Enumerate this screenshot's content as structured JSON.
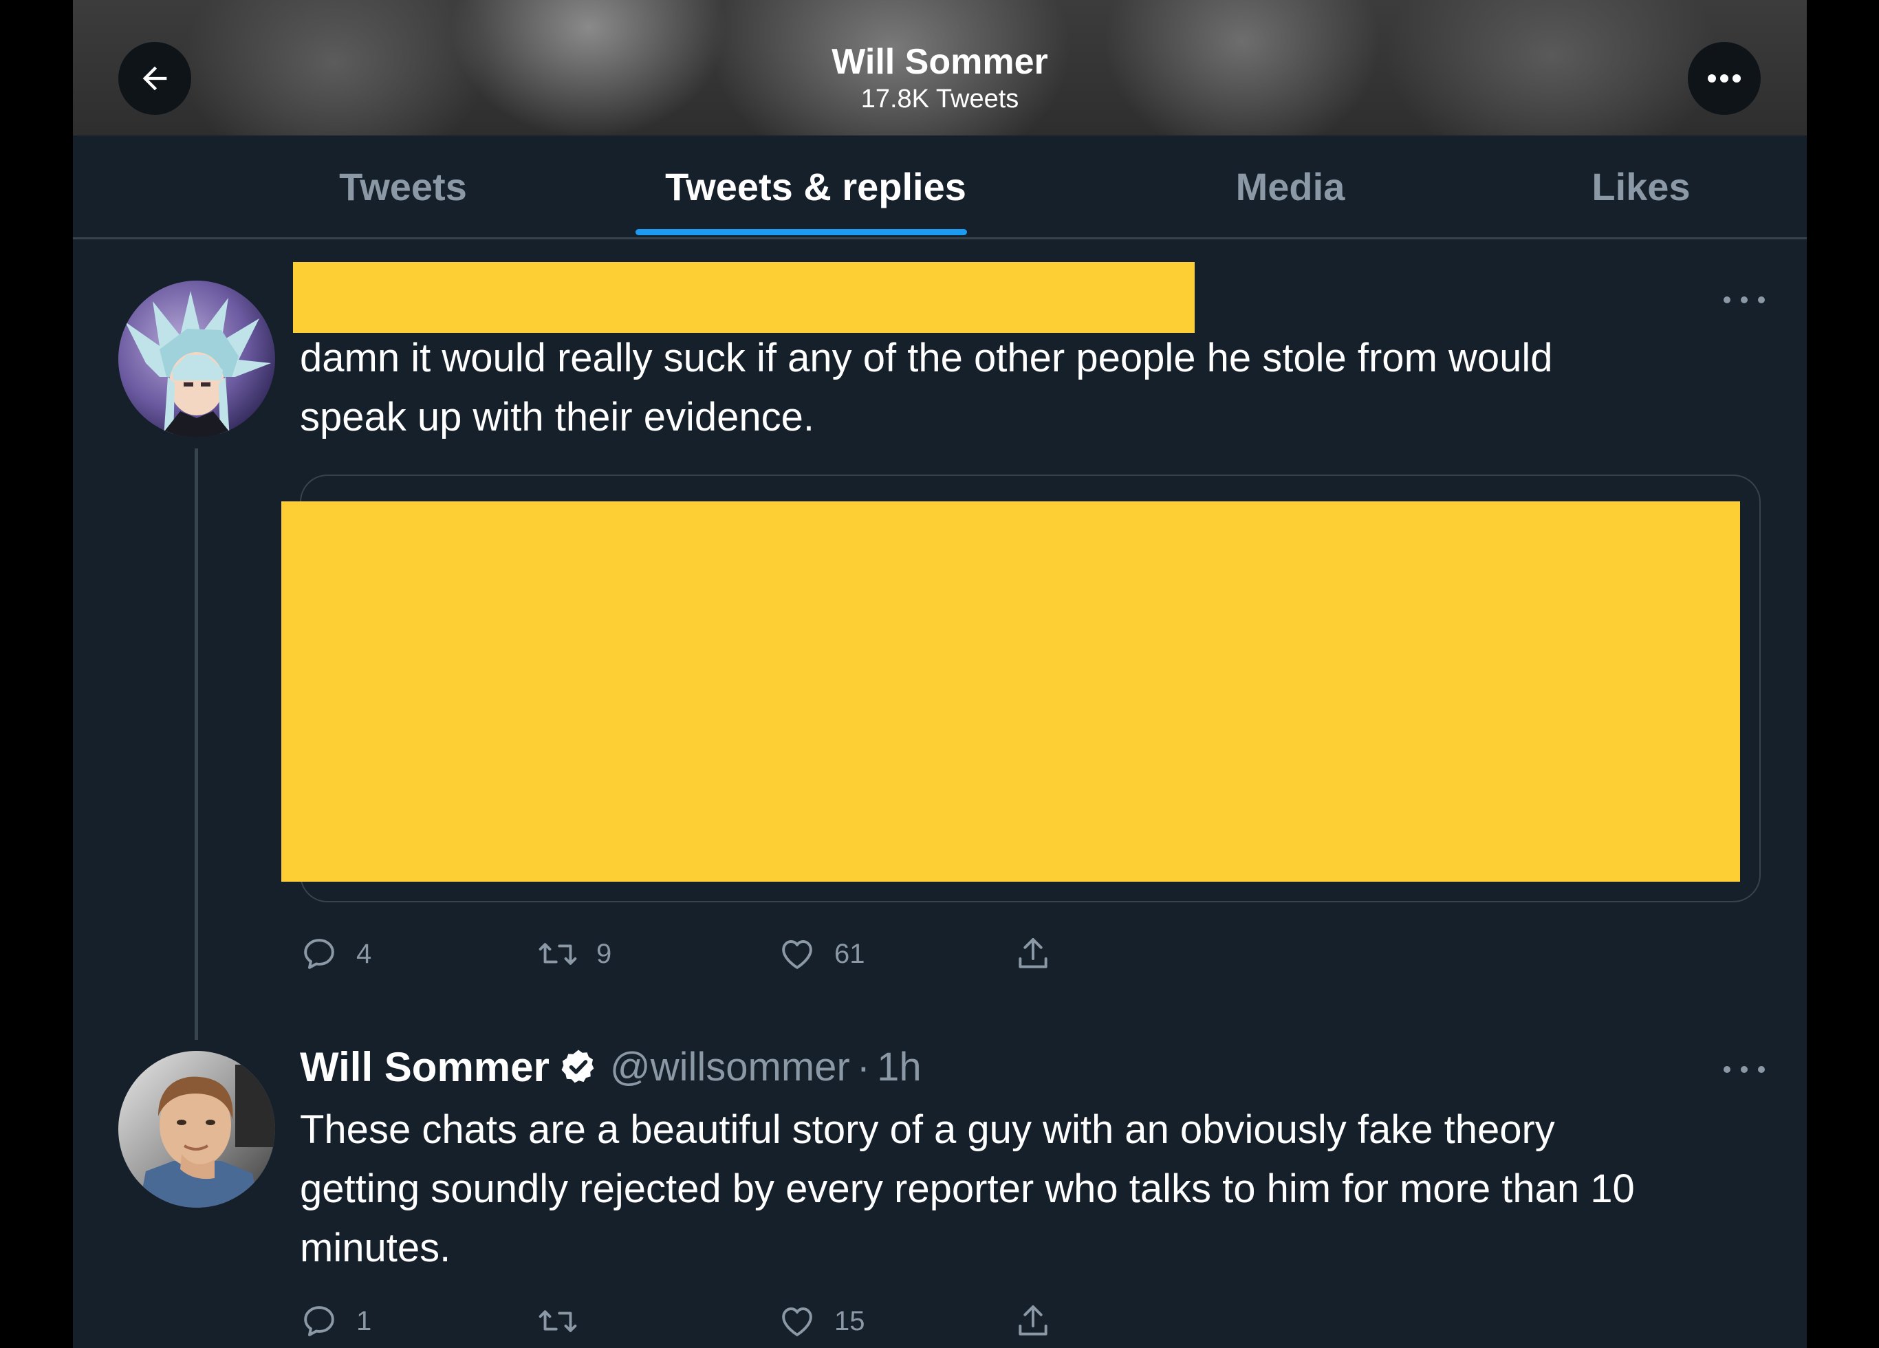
{
  "header": {
    "title": "Will Sommer",
    "tweet_count": "17.8K Tweets"
  },
  "tabs": [
    {
      "label": "Tweets",
      "active": false
    },
    {
      "label": "Tweets & replies",
      "active": true
    },
    {
      "label": "Media",
      "active": false
    },
    {
      "label": "Likes",
      "active": false
    }
  ],
  "colors": {
    "background": "#15202b",
    "accent": "#1d9bf0",
    "redaction": "#fecf34",
    "muted_text": "#8b98a5",
    "divider": "#38444d"
  },
  "tweets": [
    {
      "author_redacted": true,
      "text_lines": [
        "damn it would really suck if any of the other people he stole from would",
        "speak up with their evidence."
      ],
      "quoted_tweet_redacted": true,
      "reply_count": "4",
      "retweet_count": "9",
      "like_count": "61"
    },
    {
      "author_name": "Will Sommer",
      "verified": true,
      "handle": "@willsommer",
      "separator": "·",
      "time": "1h",
      "text_lines": [
        "These chats are a beautiful story of a guy with an obviously fake theory",
        "getting soundly rejected by every reporter who talks to him for more than 10",
        "minutes."
      ],
      "reply_count": "1",
      "retweet_count": "",
      "like_count": "15"
    }
  ],
  "icons": {
    "back": "arrow-left-icon",
    "more": "more-horizontal-icon",
    "reply": "speech-bubble-icon",
    "retweet": "retweet-icon",
    "like": "heart-icon",
    "share": "share-upload-icon",
    "verified": "verified-badge-icon"
  }
}
